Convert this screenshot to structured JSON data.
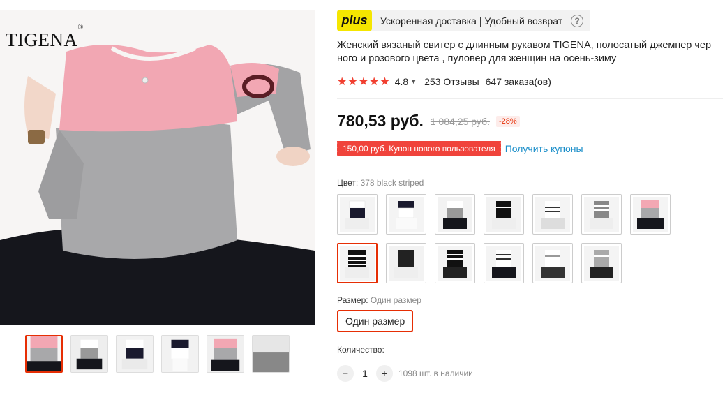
{
  "brand": {
    "logo_text": "TIGENA",
    "logo_mark": "®"
  },
  "gallery": {
    "thumb_count": 7,
    "active_thumb": 0
  },
  "plus": {
    "badge": "plus",
    "text": "Ускоренная доставка | Удобный возврат",
    "help_icon": "question-icon"
  },
  "product": {
    "title": "Женский вязаный свитер с длинным рукавом TIGENA, полосатый джемпер чер ного и розового цвета , пуловер для женщин на осень-зиму"
  },
  "rating": {
    "stars": 5,
    "value": "4.8",
    "chevron": "⌄",
    "reviews": "253 Отзывы",
    "orders": "647 заказа(ов)"
  },
  "price": {
    "current": "780,53 руб.",
    "old": "1 084,25 руб.",
    "discount": "-28%"
  },
  "coupon": {
    "label": "150,00 руб. Купон нового пользователя",
    "link": "Получить купоны"
  },
  "color": {
    "label": "Цвет:",
    "value": "378 black striped",
    "selected_index": 7,
    "swatch_count": 13
  },
  "size": {
    "label": "Размер:",
    "value": "Один размер",
    "button": "Один размер"
  },
  "quantity": {
    "label": "Количество:",
    "minus": "−",
    "value": "1",
    "plus": "+",
    "stock": "1098 шт. в наличии"
  },
  "colors": {
    "accent": "#e62e04",
    "coupon_bg": "#f0433b",
    "link": "#1a8ec9",
    "star": "#f13f30",
    "plus_badge": "#f5e600"
  }
}
